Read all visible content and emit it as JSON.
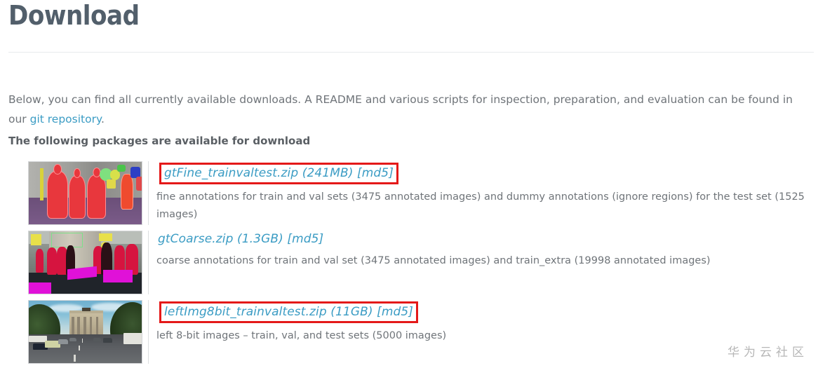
{
  "header": {
    "title": "Download"
  },
  "intro": {
    "text_before_link": "Below, you can find all currently available downloads. A README and various scripts for inspection, preparation, and evaluation can be found in our ",
    "link_label": "git repository",
    "text_after_link": "."
  },
  "section": {
    "heading": "The following packages are available for download"
  },
  "packages": [
    {
      "link": "gtFine_trainvaltest.zip (241MB) [md5]",
      "description": "fine annotations for train and val sets (3475 annotated images) and dummy annotations (ignore regions) for the test set (1525 images)",
      "highlighted": true,
      "thumbnail_name": "fine-annotation-pedestrians-thumbnail"
    },
    {
      "link": "gtCoarse.zip (1.3GB) [md5]",
      "description": "coarse annotations for train and val set (3475 annotated images) and train_extra (19998 annotated images)",
      "highlighted": false,
      "thumbnail_name": "coarse-annotation-street-thumbnail"
    },
    {
      "link": "leftImg8bit_trainvaltest.zip (11GB) [md5]",
      "description": "left 8-bit images – train, val, and test sets (5000 images)",
      "highlighted": true,
      "thumbnail_name": "brandenburg-gate-street-thumbnail"
    }
  ],
  "watermark": {
    "text": "华为云社区"
  },
  "colors": {
    "title": "#525f6b",
    "link": "#3b9cc4",
    "body_text": "#6f7479",
    "highlight_box": "#e41919",
    "background": "#ffffff"
  }
}
